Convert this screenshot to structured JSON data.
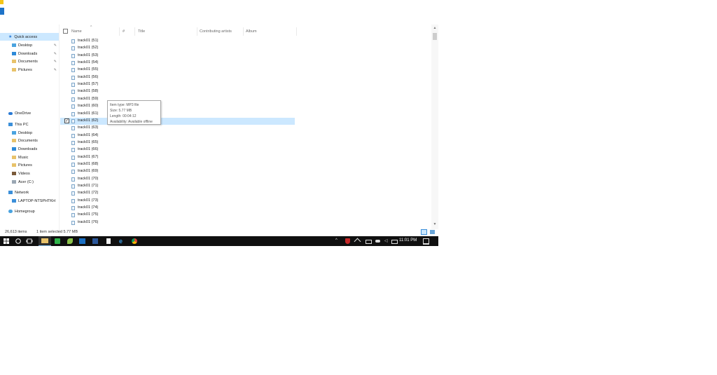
{
  "colors": {
    "selection": "#cce8ff",
    "taskbar": "#101010",
    "folder": "#e8c26a",
    "accent": "#1e73c8"
  },
  "nav": {
    "quick_access": "Quick access",
    "qa_desktop": "Desktop",
    "qa_downloads": "Downloads",
    "qa_documents": "Documents",
    "qa_pictures": "Pictures",
    "onedrive": "OneDrive",
    "this_pc": "This PC",
    "pc_desktop": "Desktop",
    "pc_documents": "Documents",
    "pc_downloads": "Downloads",
    "pc_music": "Music",
    "pc_pictures": "Pictures",
    "pc_videos": "Videos",
    "pc_drive": "Acer (C:)",
    "network": "Network",
    "laptop": "LAPTOP-NTSPHTKH",
    "homegroup": "Homegroup"
  },
  "columns": {
    "name": "Name",
    "number": "#",
    "title": "Title",
    "artists": "Contributing artists",
    "album": "Album"
  },
  "files": [
    "track01 (51)",
    "track01 (52)",
    "track01 (53)",
    "track01 (54)",
    "track01 (55)",
    "track01 (56)",
    "track01 (57)",
    "track01 (58)",
    "track01 (59)",
    "track01 (60)",
    "track01 (61)",
    "track01 (62)",
    "track01 (63)",
    "track01 (64)",
    "track01 (65)",
    "track01 (66)",
    "track01 (67)",
    "track01 (68)",
    "track01 (69)",
    "track01 (70)",
    "track01 (71)",
    "track01 (72)",
    "track01 (73)",
    "track01 (74)",
    "track01 (75)",
    "track01 (76)"
  ],
  "selected_index": 11,
  "tooltip": {
    "type": "Item type: MP3 file",
    "size": "Size: 5.77 MB",
    "length": "Length: 00:04:12",
    "availability": "Availability: Available offline"
  },
  "status": {
    "count": "26,613 items",
    "selection": "1 item selected  5.77 MB"
  },
  "taskbar": {
    "time": "11:01 PM"
  }
}
